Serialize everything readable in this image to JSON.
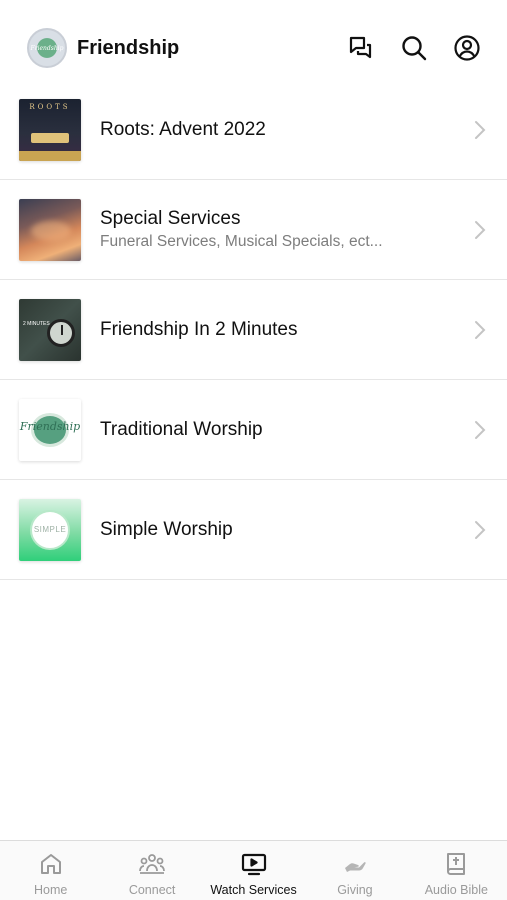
{
  "header": {
    "title": "Friendship",
    "logo_text": "Friendship",
    "icons": [
      "chat-icon",
      "search-icon",
      "profile-icon"
    ]
  },
  "list": [
    {
      "title": "Roots: Advent 2022",
      "subtitle": "",
      "thumb_text": "ROOTS"
    },
    {
      "title": "Special Services",
      "subtitle": "Funeral Services, Musical Specials, ect...",
      "thumb_text": ""
    },
    {
      "title": "Friendship In 2 Minutes",
      "subtitle": "",
      "thumb_text": "2 MINUTES"
    },
    {
      "title": "Traditional Worship",
      "subtitle": "",
      "thumb_text": "Friendship"
    },
    {
      "title": "Simple Worship",
      "subtitle": "",
      "thumb_text": "SIMPLE"
    }
  ],
  "tabbar": {
    "tabs": [
      {
        "label": "Home",
        "icon": "home-icon",
        "active": false
      },
      {
        "label": "Connect",
        "icon": "people-icon",
        "active": false
      },
      {
        "label": "Watch Services",
        "icon": "tv-play-icon",
        "active": true
      },
      {
        "label": "Giving",
        "icon": "hand-icon",
        "active": false
      },
      {
        "label": "Audio Bible",
        "icon": "bible-icon",
        "active": false
      }
    ]
  },
  "colors": {
    "active_tab": "#111111",
    "inactive_tab": "#9a9a9a",
    "subtitle": "#7d7d7d",
    "divider": "#e6e6e6"
  }
}
